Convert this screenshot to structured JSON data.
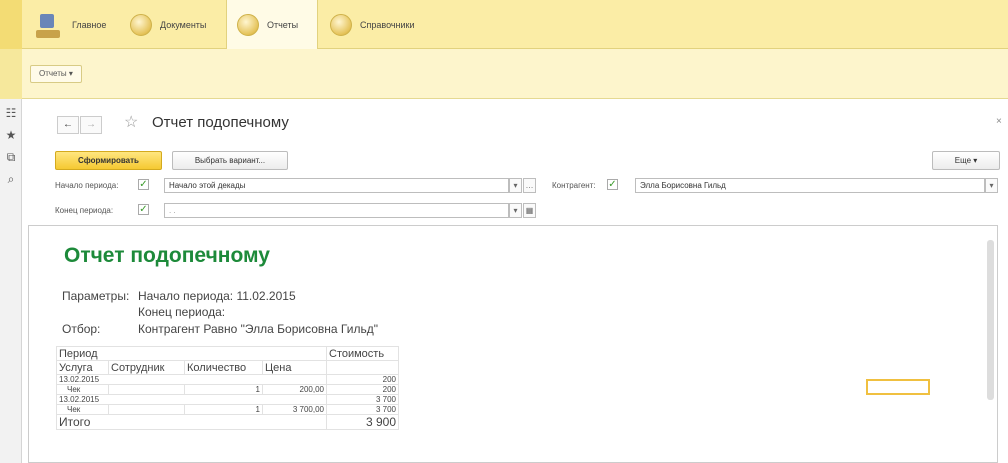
{
  "sections": [
    {
      "label": "Главное",
      "icon": "home-icon"
    },
    {
      "label": "Документы",
      "icon": "documents-icon"
    },
    {
      "label": "Отчеты",
      "icon": "reports-icon"
    },
    {
      "label": "Справочники",
      "icon": "catalogs-icon"
    }
  ],
  "subbar": {
    "reports_menu": "Отчеты ▾"
  },
  "header": {
    "title": "Отчет подопечному",
    "back": "←",
    "forward": "→",
    "star": "☆",
    "close": "×"
  },
  "toolbar": {
    "generate": "Сформировать",
    "choose_variant": "Выбрать вариант...",
    "more": "Еще ▾"
  },
  "filters": {
    "period_start_label": "Начало периода:",
    "period_start_value": "Начало этой декады",
    "period_end_label": "Конец периода:",
    "period_end_value": ". .",
    "counterparty_label": "Контрагент:",
    "counterparty_value": "Элла Борисовна Гильд"
  },
  "report": {
    "title": "Отчет подопечному",
    "params_label": "Параметры:",
    "param_start": "Начало периода: 11.02.2015",
    "param_end": "Конец периода:",
    "filter_label": "Отбор:",
    "filter_value": "Контрагент Равно \"Элла Борисовна Гильд\"",
    "header_row1": {
      "period": "Период",
      "cost": "Стоимость"
    },
    "header_row2": {
      "service": "Услуга",
      "employee": "Сотрудник",
      "qty": "Количество",
      "price": "Цена"
    },
    "rows": [
      {
        "c0": "13.02.2015",
        "c4": "200"
      },
      {
        "c0": "Чек",
        "c3": "1",
        "c4p": "200,00",
        "c4": "200"
      },
      {
        "c0": "13.02.2015",
        "c4": "3 700"
      },
      {
        "c0": "Чек",
        "c3": "1",
        "c4p": "3 700,00",
        "c4": "3 700"
      }
    ],
    "total_label": "Итого",
    "total_value": "3 900"
  }
}
